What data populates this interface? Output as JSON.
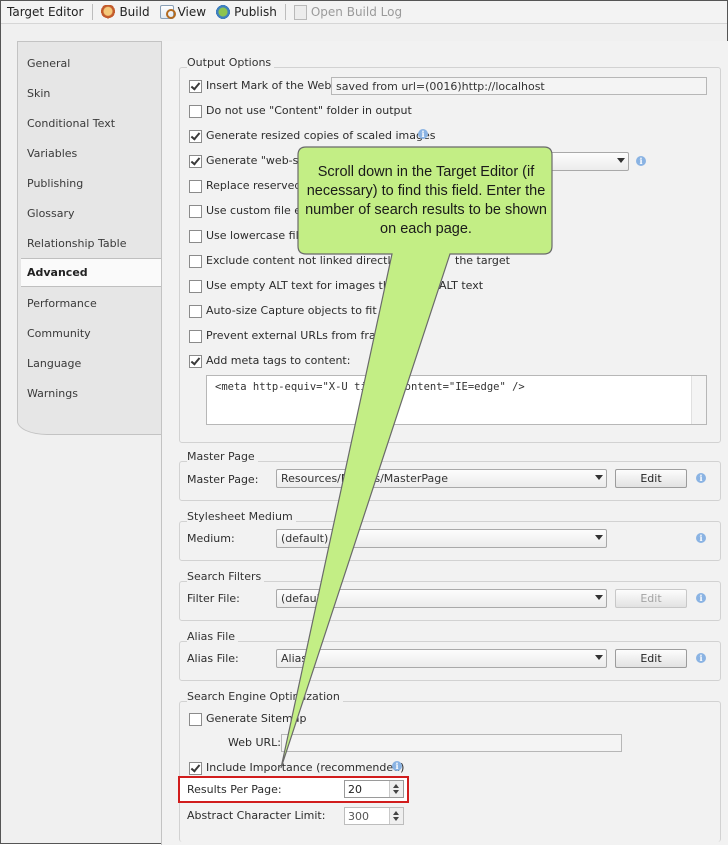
{
  "toolbar": {
    "title": "Target Editor",
    "build": "Build",
    "view": "View",
    "publish": "Publish",
    "open_build_log": "Open Build Log"
  },
  "nav": {
    "items": [
      "General",
      "Skin",
      "Conditional Text",
      "Variables",
      "Publishing",
      "Glossary",
      "Relationship Table",
      "Advanced",
      "Performance",
      "Community",
      "Language",
      "Warnings"
    ],
    "active": "Advanced"
  },
  "output_options": {
    "title": "Output Options",
    "insert_motw": {
      "label": "Insert Mark of the Web",
      "checked": true,
      "value": "saved from url=(0016)http://localhost"
    },
    "no_content_folder": {
      "label": "Do not use \"Content\" folder in output",
      "checked": false
    },
    "resized_copies": {
      "label": "Generate resized copies of scaled images",
      "checked": true
    },
    "web_safe": {
      "label": "Generate \"web-safe",
      "checked": true
    },
    "replace_reserved": {
      "label": "Replace reserved ch",
      "checked": false
    },
    "custom_ext": {
      "label": "Use custom file exte",
      "checked": false
    },
    "lowercase": {
      "label": "Use lowercase filena",
      "checked": false
    },
    "exclude_content": {
      "label": "Exclude content not linked directly or",
      "tail": "the target",
      "checked": false
    },
    "empty_alt": {
      "label": "Use empty ALT text for images that",
      "tail": "ALT text",
      "checked": false
    },
    "autosize_capture": {
      "label": "Auto-size Capture objects to fit tex",
      "checked": false
    },
    "prevent_frame": {
      "label": "Prevent external URLs from frame",
      "checked": false
    },
    "meta_tags": {
      "label": "Add meta tags to content:",
      "checked": true,
      "value": "<meta http-equiv=\"X-U           tible\" content=\"IE=edge\" />"
    }
  },
  "master_page": {
    "title": "Master Page",
    "label": "Master Page:",
    "value": "Resources/M          ages/MasterPage",
    "edit": "Edit"
  },
  "stylesheet_medium": {
    "title": "Stylesheet Medium",
    "label": "Medium:",
    "value": "(default)"
  },
  "search_filters": {
    "title": "Search Filters",
    "label": "Filter File:",
    "value": "(defaul",
    "edit": "Edit"
  },
  "alias_file": {
    "title": "Alias File",
    "label": "Alias File:",
    "value": "Alias",
    "edit": "Edit"
  },
  "seo": {
    "title": "Search Engine Optimization",
    "sitemap": {
      "label": "Generate Sitemap",
      "checked": false
    },
    "web_url_label": "Web URL:",
    "importance": {
      "label": "Include Importance (recommended)",
      "checked": true
    },
    "results_per_page": {
      "label": "Results Per Page:",
      "value": "20"
    },
    "abstract_limit": {
      "label": "Abstract Character Limit:",
      "value": "300"
    }
  },
  "callout": {
    "text": "Scroll down in the Target Editor (if necessary) to find this field. Enter the number of search results to be shown on each page."
  },
  "colors": {
    "callout_fill": "#c3ee85",
    "callout_stroke": "#6a6a6a",
    "highlight": "#d11d1d"
  }
}
